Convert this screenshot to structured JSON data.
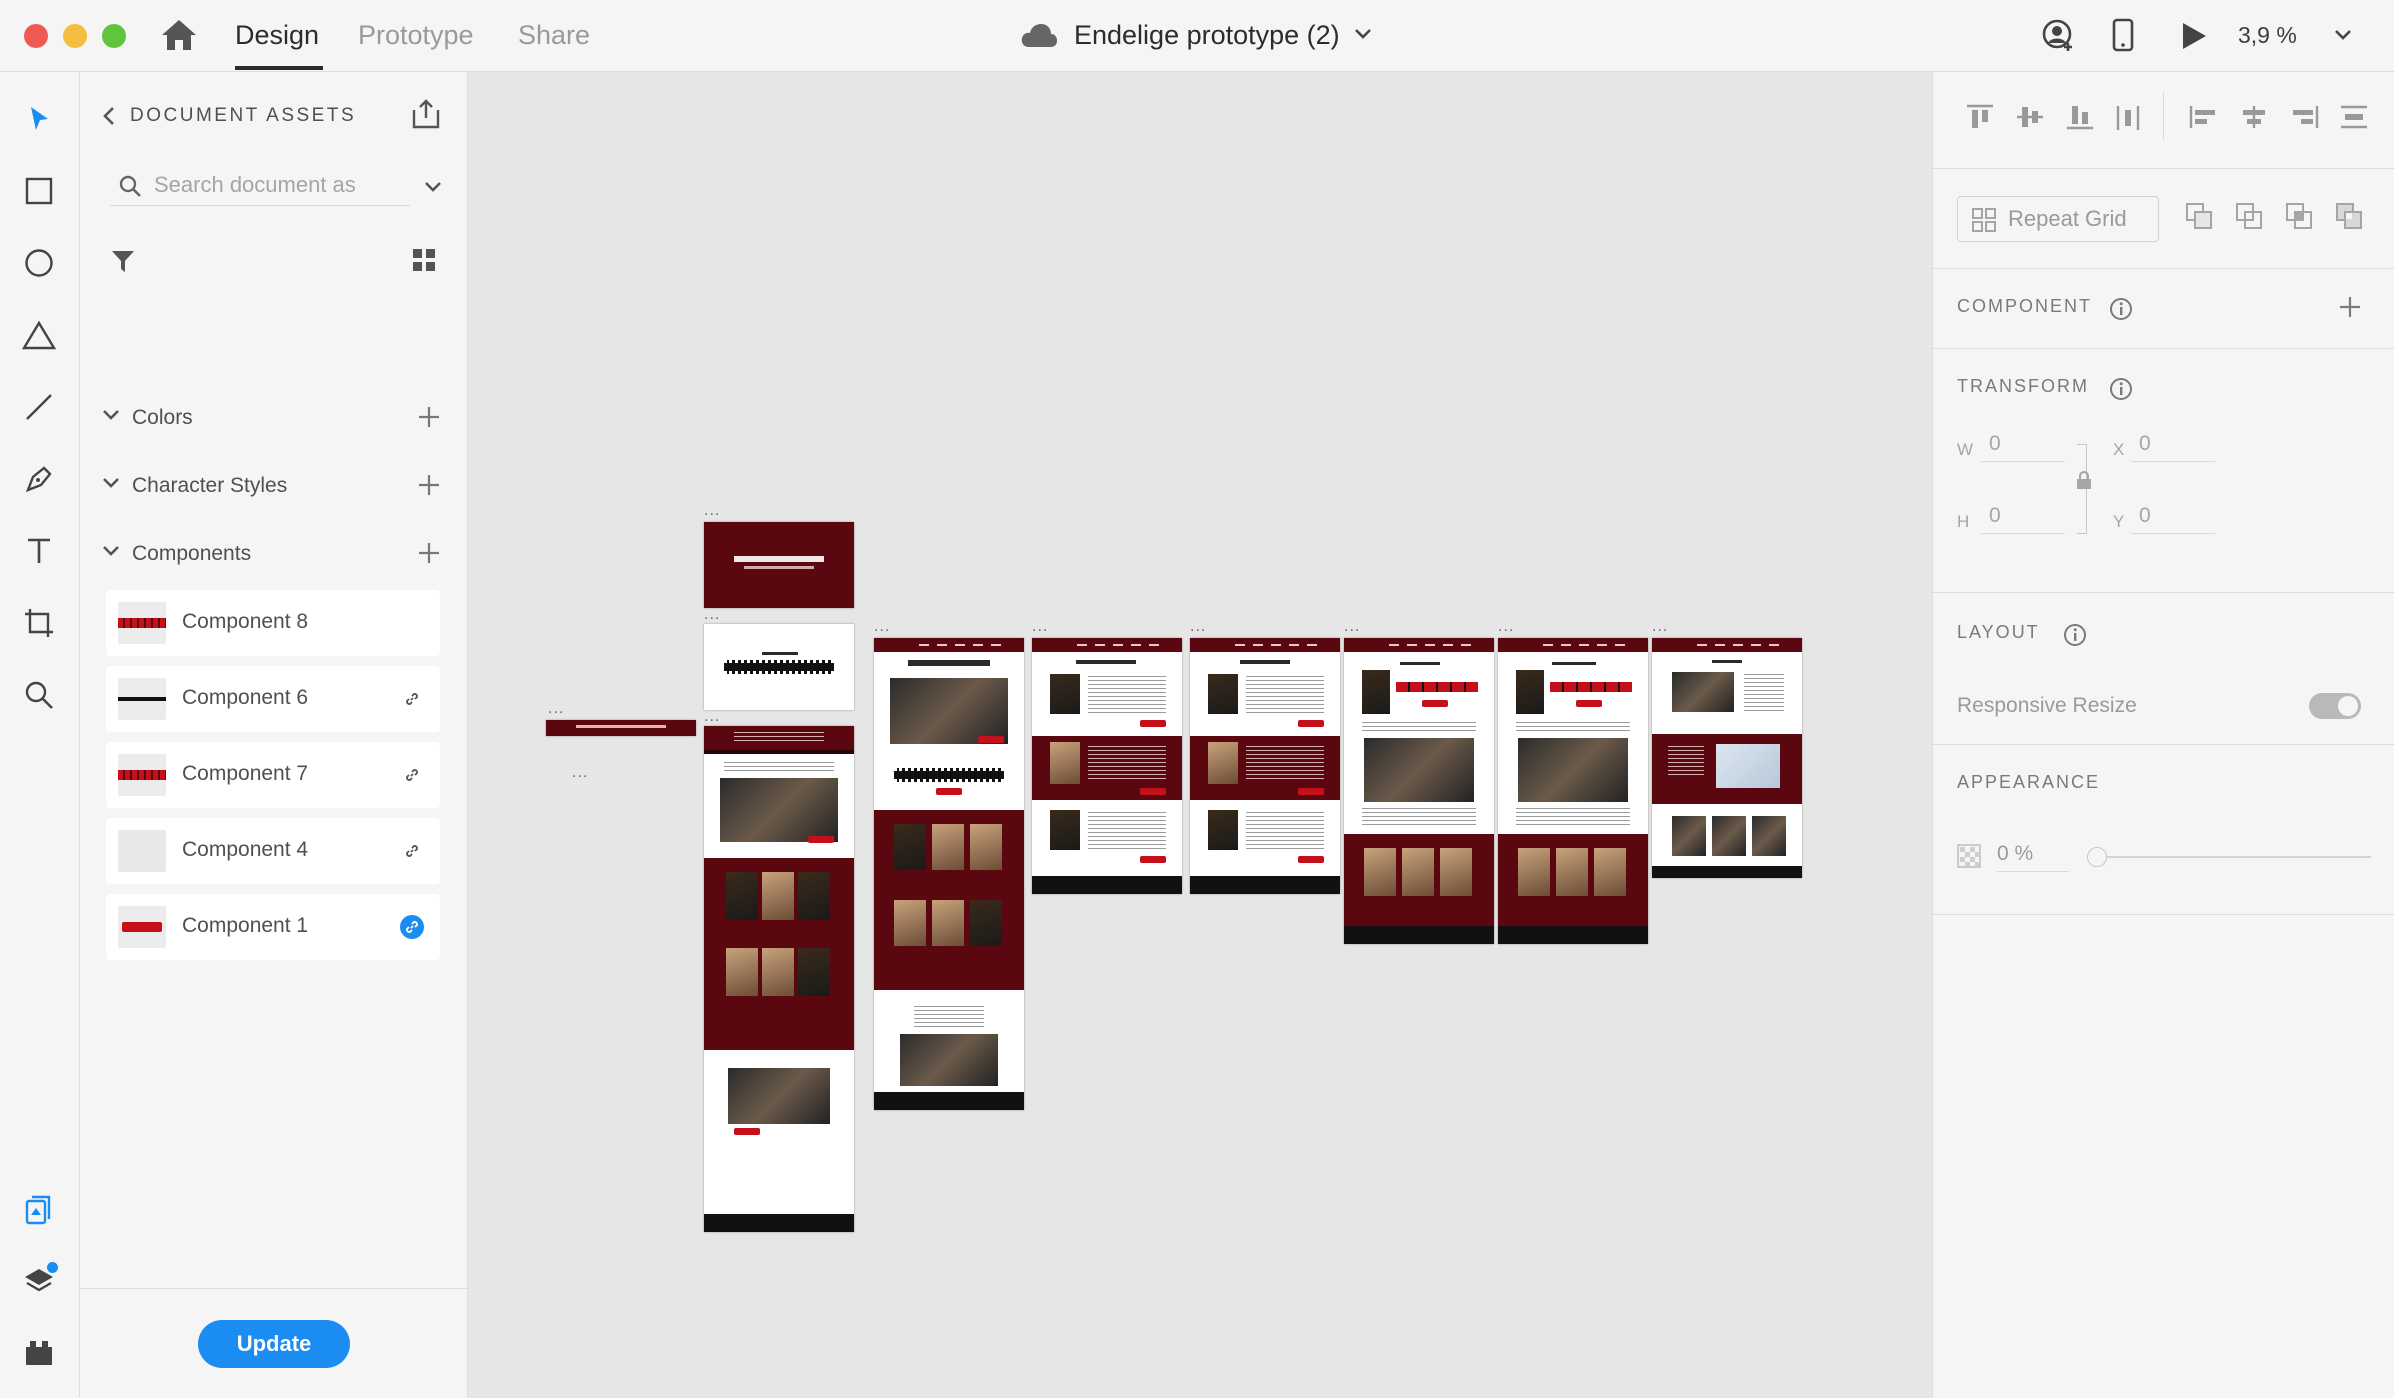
{
  "titlebar": {
    "tabs": {
      "design": "Design",
      "prototype": "Prototype",
      "share": "Share"
    },
    "doc_title": "Endelige prototype (2)",
    "zoom": "3,9 %"
  },
  "toolbar": {
    "tools": [
      "select-tool",
      "rectangle-tool",
      "ellipse-tool",
      "polygon-tool",
      "line-tool",
      "pen-tool",
      "text-tool",
      "artboard-tool",
      "zoom-tool"
    ],
    "bottom": [
      "document-assets",
      "layers",
      "plugins"
    ]
  },
  "assets": {
    "title": "DOCUMENT ASSETS",
    "search_placeholder": "Search document as",
    "sections": {
      "colors": "Colors",
      "character_styles": "Character Styles",
      "components": "Components"
    },
    "components": [
      {
        "name": "Component 8",
        "linked": false
      },
      {
        "name": "Component 6",
        "linked": true
      },
      {
        "name": "Component 7",
        "linked": true
      },
      {
        "name": "Component 4",
        "linked": true
      },
      {
        "name": "Component 1",
        "linked": true,
        "active": true
      }
    ],
    "update_label": "Update"
  },
  "canvas": {
    "artboard_marker": "..."
  },
  "props": {
    "repeat_grid": "Repeat Grid",
    "component_label": "COMPONENT",
    "transform_label": "TRANSFORM",
    "transform": {
      "w_label": "W",
      "w": "0",
      "h_label": "H",
      "h": "0",
      "x_label": "X",
      "x": "0",
      "y_label": "Y",
      "y": "0"
    },
    "layout_label": "LAYOUT",
    "responsive_resize": "Responsive Resize",
    "appearance_label": "APPEARANCE",
    "opacity": "0 %"
  },
  "colors": {
    "accent": "#1b8cf2",
    "brand_wine": "#5a0710",
    "brand_red": "#c4101a"
  }
}
